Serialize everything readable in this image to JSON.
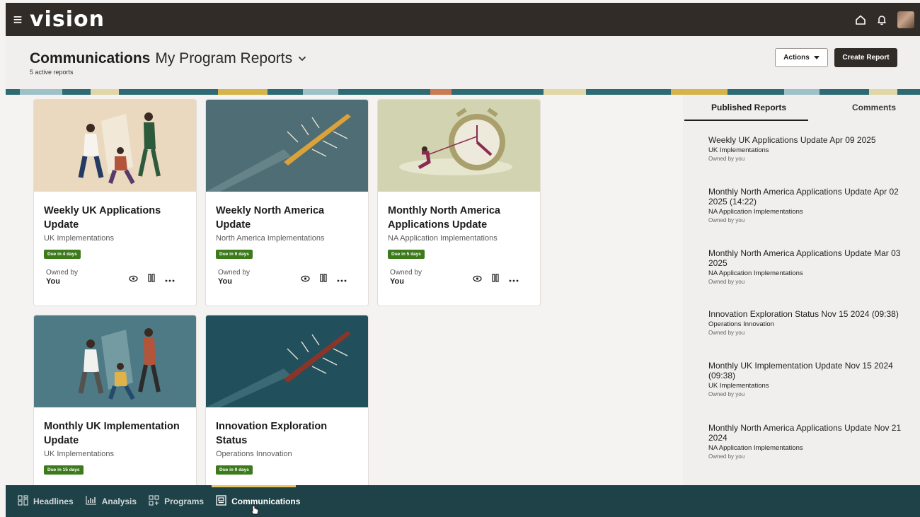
{
  "topbar": {
    "logo": "vision",
    "menu_icon": "hamburger-icon",
    "home_icon": "home-icon",
    "bell_icon": "bell-icon"
  },
  "header": {
    "title_bold": "Communications",
    "title_light": "My Program Reports",
    "subtitle": "5 active reports",
    "actions_label": "Actions",
    "create_label": "Create Report"
  },
  "cards": [
    {
      "title": "Weekly UK Applications Update",
      "subtitle": "UK Implementations",
      "badge": "Due in 4 days",
      "owned_label": "Owned by",
      "owner": "You"
    },
    {
      "title": "Weekly North America Update",
      "subtitle": "North America Implementations",
      "badge": "Due in 9 days",
      "owned_label": "Owned by",
      "owner": "You"
    },
    {
      "title": "Monthly North America Applications Update",
      "subtitle": "NA Application Implementations",
      "badge": "Due in 5 days",
      "owned_label": "Owned by",
      "owner": "You"
    },
    {
      "title": "Monthly UK Implementation Update",
      "subtitle": "UK Implementations",
      "badge": "Due in 15 days"
    },
    {
      "title": "Innovation Exploration Status",
      "subtitle": "Operations Innovation",
      "badge": "Due in 9 days"
    }
  ],
  "panel": {
    "tabs": [
      "Published Reports",
      "Comments"
    ],
    "items": [
      {
        "title": "Weekly UK Applications Update Apr 09 2025",
        "org": "UK Implementations",
        "owner": "Owned by you"
      },
      {
        "title": "Monthly North America Applications Update Apr 02 2025 (14:22)",
        "org": "NA Application Implementations",
        "owner": "Owned by you"
      },
      {
        "title": "Monthly North America Applications Update Mar 03 2025",
        "org": "NA Application Implementations",
        "owner": "Owned by you"
      },
      {
        "title": "Innovation Exploration Status Nov 15 2024 (09:38)",
        "org": "Operations Innovation",
        "owner": "Owned by you"
      },
      {
        "title": "Monthly UK Implementation Update Nov 15 2024 (09:38)",
        "org": "UK Implementations",
        "owner": "Owned by you"
      },
      {
        "title": "Monthly North America Applications Update Nov 21 2024",
        "org": "NA Application Implementations",
        "owner": "Owned by you"
      }
    ]
  },
  "nav": {
    "items": [
      "Headlines",
      "Analysis",
      "Programs",
      "Communications"
    ],
    "active": "Communications"
  },
  "colors": {
    "topbar": "#312c28",
    "bottombar": "#1f4148",
    "badge": "#3c7a1c",
    "active_accent": "#e9c56a"
  }
}
